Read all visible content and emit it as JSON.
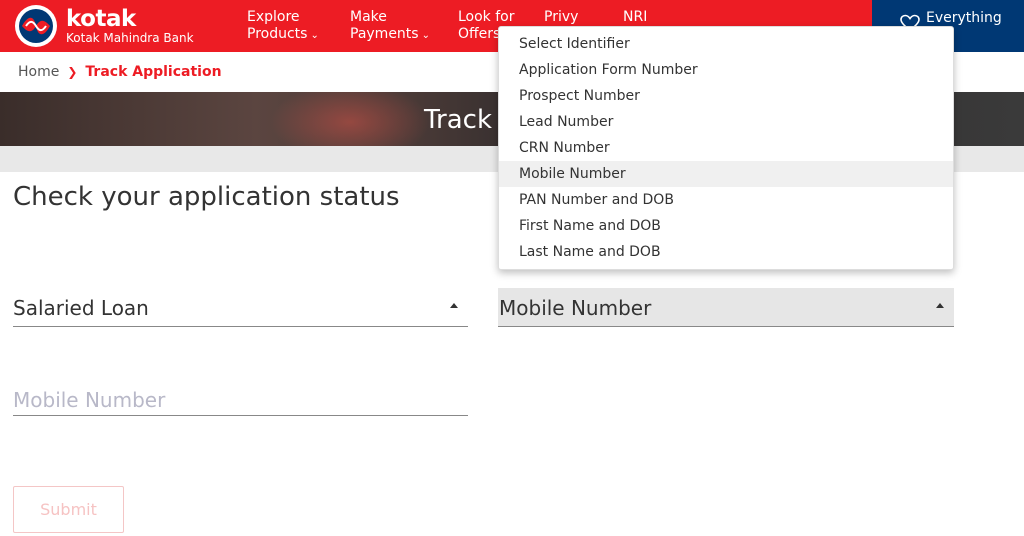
{
  "header": {
    "logo_name": "kotak",
    "logo_sub": "Kotak Mahindra Bank",
    "nav": [
      {
        "line1": "Explore",
        "line2": "Products"
      },
      {
        "line1": "Make",
        "line2": "Payments"
      },
      {
        "line1": "Look for",
        "line2": "Offers"
      },
      {
        "line1": "Privy",
        "line2": ""
      },
      {
        "line1": "NRI",
        "line2": ""
      }
    ],
    "everything_me": "Everything Me"
  },
  "breadcrumb": {
    "home": "Home",
    "current": "Track Application"
  },
  "banner": {
    "title": "Track"
  },
  "main": {
    "title": "Check your application status",
    "loan_select_value": "Salaried Loan",
    "identifier_select_value": "Mobile Number",
    "mobile_placeholder": "Mobile Number",
    "submit_label": "Submit"
  },
  "dropdown": {
    "options": [
      "Select Identifier",
      "Application Form Number",
      "Prospect Number",
      "Lead Number",
      "CRN Number",
      "Mobile Number",
      "PAN Number and DOB",
      "First Name and DOB",
      "Last Name and DOB"
    ],
    "highlighted_index": 5
  },
  "colors": {
    "brand_red": "#ed1c24",
    "brand_navy": "#003874"
  }
}
